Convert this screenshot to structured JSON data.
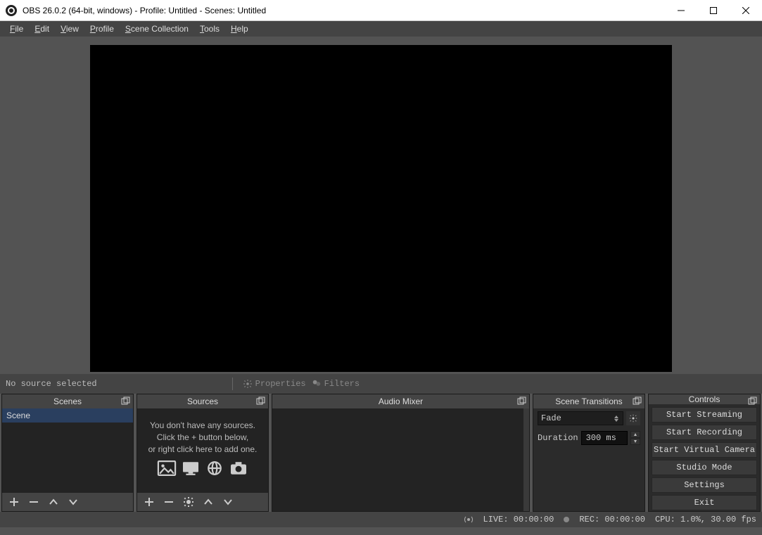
{
  "window": {
    "title": "OBS 26.0.2 (64-bit, windows) - Profile: Untitled - Scenes: Untitled"
  },
  "menu": {
    "file": "File",
    "edit": "Edit",
    "view": "View",
    "profile": "Profile",
    "scene_collection": "Scene Collection",
    "tools": "Tools",
    "help": "Help"
  },
  "context": {
    "no_source": "No source selected",
    "properties": "Properties",
    "filters": "Filters"
  },
  "docks": {
    "scenes": {
      "title": "Scenes",
      "items": [
        "Scene"
      ]
    },
    "sources": {
      "title": "Sources",
      "empty_line1": "You don't have any sources.",
      "empty_line2": "Click the + button below,",
      "empty_line3": "or right click here to add one."
    },
    "mixer": {
      "title": "Audio Mixer"
    },
    "transitions": {
      "title": "Scene Transitions",
      "selected": "Fade",
      "duration_label": "Duration",
      "duration_value": "300 ms"
    },
    "controls": {
      "title": "Controls",
      "buttons": {
        "start_streaming": "Start Streaming",
        "start_recording": "Start Recording",
        "start_virtual_camera": "Start Virtual Camera",
        "studio_mode": "Studio Mode",
        "settings": "Settings",
        "exit": "Exit"
      }
    }
  },
  "status": {
    "live": "LIVE: 00:00:00",
    "rec": "REC: 00:00:00",
    "cpu": "CPU: 1.0%, 30.00 fps"
  }
}
